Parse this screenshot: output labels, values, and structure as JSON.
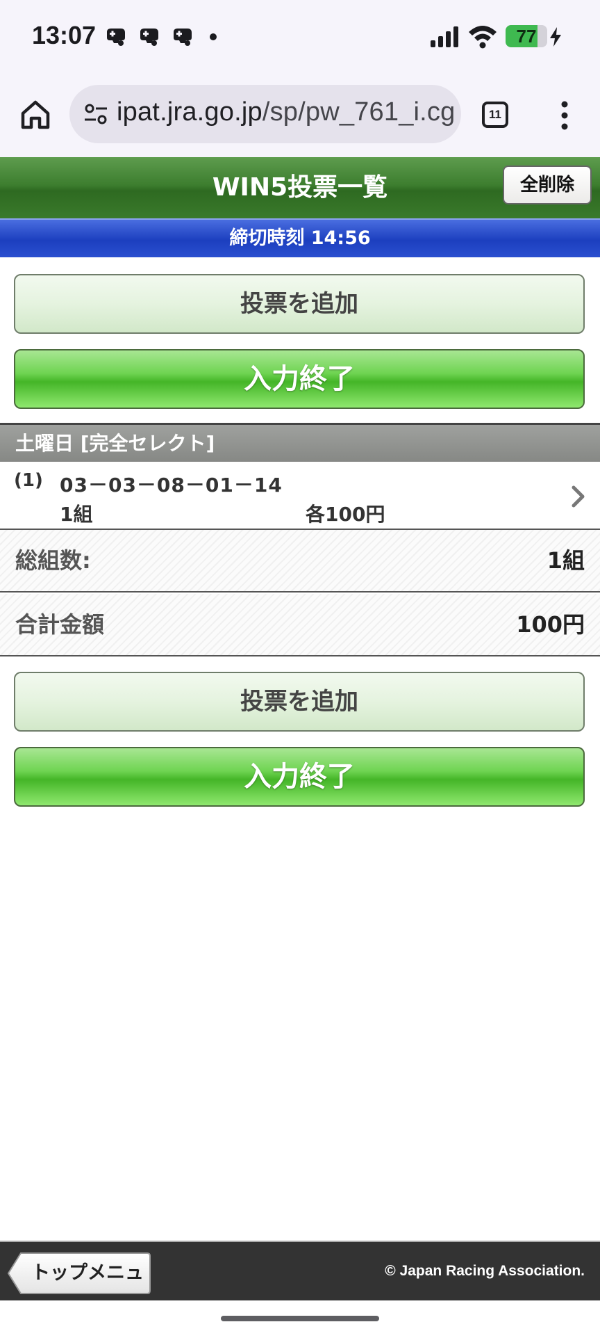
{
  "status_bar": {
    "time": "13:07",
    "battery_level": "77",
    "battery_fraction": 0.77,
    "notification_icons": [
      "game-controller-icon",
      "game-controller-icon",
      "game-controller-icon"
    ]
  },
  "browser": {
    "url_domain": "ipat.jra.go.jp",
    "url_path": "/sp/pw_761_i.cg",
    "tab_count": "11"
  },
  "header": {
    "title": "WIN5投票一覧",
    "delete_all_label": "全削除"
  },
  "deadline": {
    "text": "締切時刻 14:56"
  },
  "buttons": {
    "add_vote": "投票を追加",
    "finish_input": "入力終了"
  },
  "section": {
    "title": "土曜日 [完全セレクト]"
  },
  "bets": [
    {
      "index": "(1)",
      "combination": "03－03－08－01－14",
      "count": "1組",
      "unit_amount": "各100円"
    }
  ],
  "totals": {
    "combos_label": "総組数:",
    "combos_value": "1組",
    "amount_label": "合計金額",
    "amount_value": "100円"
  },
  "footer": {
    "top_menu_label": "トップメニュー",
    "copyright": "© Japan Racing Association."
  },
  "colors": {
    "header_green": "#3d7e2f",
    "deadline_blue": "#1c3fbf",
    "button_green": "#44b527",
    "footer_dark": "#333333"
  }
}
